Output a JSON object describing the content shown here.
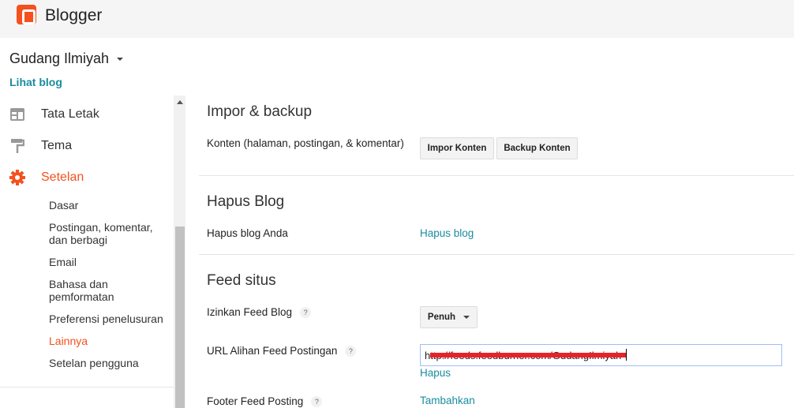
{
  "header": {
    "brand": "Blogger"
  },
  "blog": {
    "name": "Gudang Ilmiyah",
    "view_link": "Lihat blog"
  },
  "sidebar": {
    "items": [
      {
        "label": "Tata Letak",
        "icon": "layout-icon"
      },
      {
        "label": "Tema",
        "icon": "paint-roller-icon"
      },
      {
        "label": "Setelan",
        "icon": "gear-icon"
      }
    ],
    "subitems": [
      "Dasar",
      "Postingan, komentar, dan berbagi",
      "Email",
      "Bahasa dan pemformatan",
      "Preferensi penelusuran",
      "Lainnya",
      "Setelan pengguna"
    ],
    "active_color": "#f4511e"
  },
  "main": {
    "import": {
      "title": "Impor & backup",
      "label": "Konten (halaman, postingan, & komentar)",
      "import_btn": "Impor Konten",
      "backup_btn": "Backup Konten"
    },
    "delete": {
      "title": "Hapus Blog",
      "label": "Hapus blog Anda",
      "link": "Hapus blog"
    },
    "feed": {
      "title": "Feed situs",
      "allow_label": "Izinkan Feed Blog",
      "allow_value": "Penuh",
      "redirect_label": "URL Alihan Feed Postingan",
      "redirect_value": "http://feeds.feedburner.com/GudangIlmiyah",
      "remove_link": "Hapus",
      "footer_label": "Footer Feed Posting",
      "add_link": "Tambahkan",
      "help": "?"
    }
  }
}
